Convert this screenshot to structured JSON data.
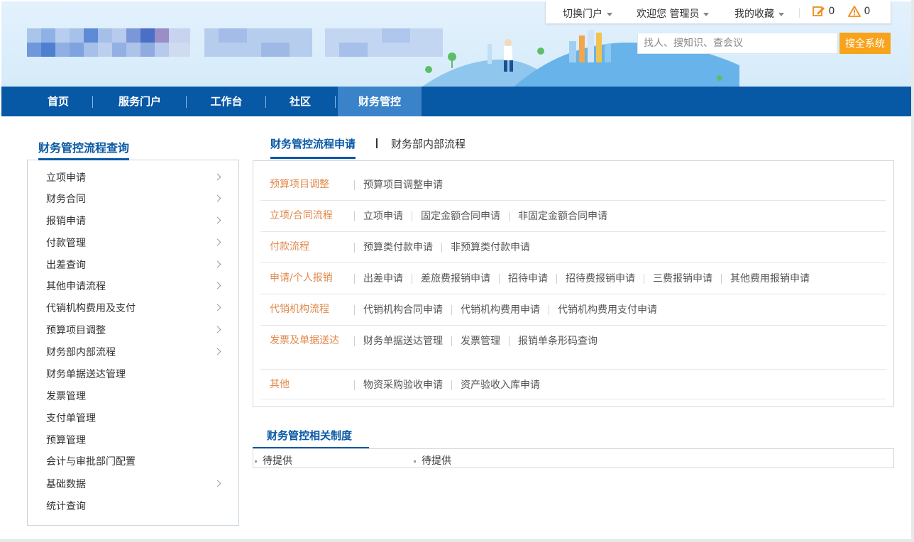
{
  "topbar": {
    "switch_portal": "切换门户",
    "welcome": "欢迎您 管理员",
    "favorites": "我的收藏",
    "todo_count": "0",
    "alert_count": "0"
  },
  "search": {
    "placeholder": "找人、搜知识、查会议",
    "button": "搜全系统"
  },
  "nav": {
    "tabs": [
      {
        "label": "首页"
      },
      {
        "label": "服务门户"
      },
      {
        "label": "工作台"
      },
      {
        "label": "社区"
      },
      {
        "label": "财务管控"
      }
    ],
    "active_index": 4
  },
  "sidebar": {
    "title": "财务管控流程查询",
    "items": [
      {
        "label": "立项申请",
        "has_children": true
      },
      {
        "label": "财务合同",
        "has_children": true
      },
      {
        "label": "报销申请",
        "has_children": true
      },
      {
        "label": "付款管理",
        "has_children": true
      },
      {
        "label": "出差查询",
        "has_children": true
      },
      {
        "label": "其他申请流程",
        "has_children": true
      },
      {
        "label": "代销机构费用及支付",
        "has_children": true
      },
      {
        "label": "预算项目调整",
        "has_children": true
      },
      {
        "label": "财务部内部流程",
        "has_children": true
      },
      {
        "label": "财务单据送达管理",
        "has_children": false
      },
      {
        "label": "发票管理",
        "has_children": false
      },
      {
        "label": "支付单管理",
        "has_children": false
      },
      {
        "label": "预算管理",
        "has_children": false
      },
      {
        "label": "会计与审批部门配置",
        "has_children": false
      },
      {
        "label": "基础数据",
        "has_children": true
      },
      {
        "label": "统计查询",
        "has_children": false
      }
    ]
  },
  "main": {
    "tabs": [
      {
        "label": "财务管控流程申请"
      },
      {
        "label": "财务部内部流程"
      }
    ],
    "flows": [
      {
        "category": "预算项目调整",
        "links": [
          "预算项目调整申请"
        ]
      },
      {
        "category": "立项/合同流程",
        "links": [
          "立项申请",
          "固定金额合同申请",
          "非固定金额合同申请"
        ]
      },
      {
        "category": "付款流程",
        "links": [
          "预算类付款申请",
          "非预算类付款申请"
        ]
      },
      {
        "category": "申请/个人报销",
        "links": [
          "出差申请",
          "差旅费报销申请",
          "招待申请",
          "招待费报销申请",
          "三费报销申请",
          "其他费用报销申请"
        ]
      },
      {
        "category": "代销机构流程",
        "links": [
          "代销机构合同申请",
          "代销机构费用申请",
          "代销机构费用支付申请"
        ]
      },
      {
        "category": "发票及单据送达",
        "links": [
          "财务单据送达管理",
          "发票管理",
          "报销单条形码查询"
        ]
      },
      {
        "category": "其他",
        "links": [
          "物资采购验收申请",
          "资产验收入库申请"
        ]
      }
    ],
    "rules_title": "财务管控相关制度",
    "rules": [
      "待提供",
      "待提供"
    ]
  },
  "colors": {
    "nav_bg": "#0758a5",
    "nav_active": "#3a83c9",
    "accent_orange": "#f7a31c",
    "category_orange": "#e08a4e"
  }
}
